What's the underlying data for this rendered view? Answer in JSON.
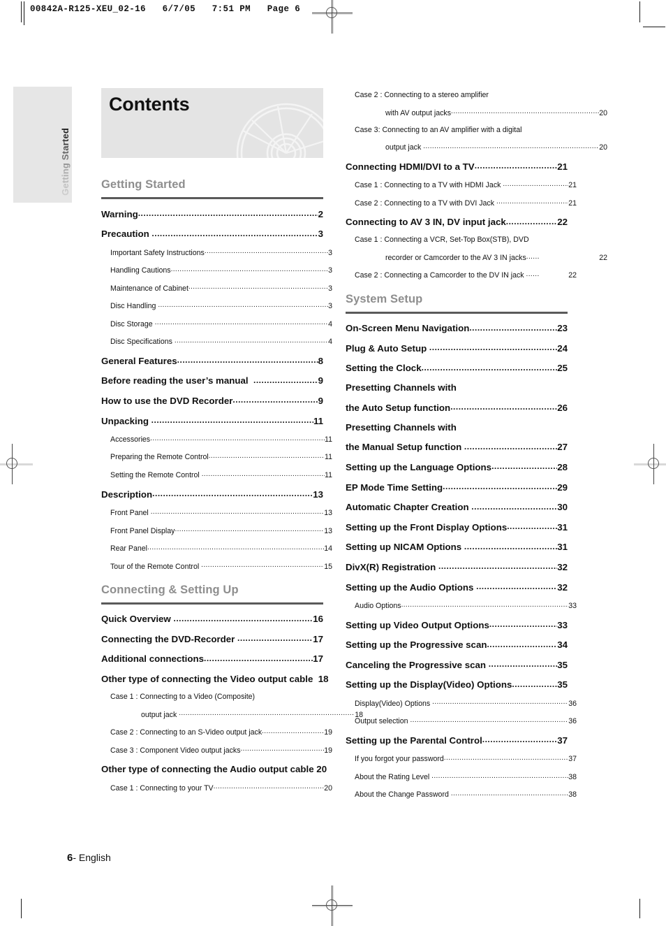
{
  "print_slug": "00842A-R125-XEU_02-16   6/7/05   7:51 PM   Page 6",
  "side_tab": {
    "label": "Getting Started"
  },
  "banner": {
    "title": "Contents",
    "graphic": "dvd-disc-illustration"
  },
  "footer": {
    "page_number": "6",
    "language": "- English"
  },
  "colors": {
    "banner_bg": "#e4e4e4",
    "section_heading": "#8e8e8e",
    "section_rule": "#5a5a5a",
    "text": "#111111",
    "side_tab_bg": "#e6e6e6"
  },
  "columns": {
    "left": [
      {
        "type": "section",
        "label": "Getting Started",
        "entries": [
          {
            "level": 1,
            "text": "Warning",
            "page": "2"
          },
          {
            "level": 1,
            "text": "Precaution ",
            "page": "3"
          },
          {
            "level": 2,
            "text": "Important Safety Instructions",
            "page": "3"
          },
          {
            "level": 2,
            "text": "Handling Cautions",
            "page": "3"
          },
          {
            "level": 2,
            "text": "Maintenance of Cabinet",
            "page": "3"
          },
          {
            "level": 2,
            "text": "Disc Handling ",
            "page": "3"
          },
          {
            "level": 2,
            "text": "Disc Storage ",
            "page": "4"
          },
          {
            "level": 2,
            "text": "Disc Specifications ",
            "page": "4"
          },
          {
            "level": 1,
            "text": "General Features",
            "page": "8"
          },
          {
            "level": 1,
            "text": "Before reading the user’s manual  ",
            "page": "9"
          },
          {
            "level": 1,
            "text": "How to use the DVD Recorder",
            "page": "9"
          },
          {
            "level": 1,
            "text": "Unpacking ",
            "page": "11"
          },
          {
            "level": 2,
            "text": "Accessories",
            "page": "11"
          },
          {
            "level": 2,
            "text": "Preparing the Remote Control",
            "page": "11"
          },
          {
            "level": 2,
            "text": "Setting the Remote Control ",
            "page": "11"
          },
          {
            "level": 1,
            "text": "Description",
            "page": "13"
          },
          {
            "level": 2,
            "text": "Front Panel ",
            "page": "13"
          },
          {
            "level": 2,
            "text": "Front Panel Display",
            "page": "13"
          },
          {
            "level": 2,
            "text": "Rear Panel",
            "page": "14"
          },
          {
            "level": 2,
            "text": "Tour of the Remote Control ",
            "page": "15"
          }
        ]
      },
      {
        "type": "section",
        "label": "Connecting & Setting Up",
        "entries": [
          {
            "level": 1,
            "text": "Quick Overview ",
            "page": "16"
          },
          {
            "level": 1,
            "text": "Connecting the DVD-Recorder ",
            "page": "17"
          },
          {
            "level": 1,
            "text": "Additional connections",
            "page": "17"
          },
          {
            "level": 1,
            "text": "Other type of connecting the Video output cable  ",
            "page": "18",
            "nodots": true
          },
          {
            "level": 2,
            "text": "Case 1 : Connecting to a Video (Composite)",
            "page": "",
            "nopage": true
          },
          {
            "level": 3,
            "text": "output jack ",
            "page": "18"
          },
          {
            "level": 2,
            "text": "Case 2 : Connecting to an S-Video output jack",
            "page": "19"
          },
          {
            "level": 2,
            "text": "Case 3 : Component Video output jacks",
            "page": "19"
          },
          {
            "level": 1,
            "text": "Other type of connecting the Audio output cable ",
            "page": "20",
            "nodots": true
          },
          {
            "level": 2,
            "text": "Case 1 : Connecting to your TV",
            "page": "20"
          }
        ]
      }
    ],
    "right": [
      {
        "type": "continuation",
        "label": "",
        "entries": [
          {
            "level": 2,
            "text": "Case 2 : Connecting to a stereo amplifier",
            "page": "",
            "nopage": true
          },
          {
            "level": 3,
            "text": "with AV output jacks",
            "page": "20"
          },
          {
            "level": 2,
            "text": "Case 3: Connecting to an AV amplifier with a digital",
            "page": "",
            "nopage": true
          },
          {
            "level": 3,
            "text": "output jack ",
            "page": "20"
          },
          {
            "level": 1,
            "text": "Connecting HDMI/DVI to a TV",
            "page": "21"
          },
          {
            "level": 2,
            "text": "Case 1 : Connecting to a TV with HDMI Jack ",
            "page": "21"
          },
          {
            "level": 2,
            "text": "Case 2 : Connecting to a TV with DVI Jack ",
            "page": "21"
          },
          {
            "level": 1,
            "text": "Connecting to AV 3 IN, DV input jack",
            "page": "22"
          },
          {
            "level": 2,
            "text": "Case 1 : Connecting a VCR, Set-Top Box(STB), DVD",
            "page": "",
            "nopage": true
          },
          {
            "level": 3,
            "text": "recorder or Camcorder to the AV 3 IN jacks",
            "page": "22",
            "nodots": true
          },
          {
            "level": 2,
            "text": "Case 2 : Connecting a Camcorder to the DV IN jack ",
            "page": "22",
            "nodots": true
          }
        ]
      },
      {
        "type": "section",
        "label": "System Setup",
        "entries": [
          {
            "level": 1,
            "text": "On-Screen Menu Navigation",
            "page": "23"
          },
          {
            "level": 1,
            "text": "Plug & Auto Setup ",
            "page": "24"
          },
          {
            "level": 1,
            "text": "Setting the Clock",
            "page": "25"
          },
          {
            "level": 1,
            "text": "Presetting Channels with",
            "page": "",
            "nopage": true
          },
          {
            "level": 1,
            "text": "the Auto Setup function",
            "page": "26"
          },
          {
            "level": 1,
            "text": "Presetting Channels with",
            "page": "",
            "nopage": true
          },
          {
            "level": 1,
            "text": "the Manual Setup function ",
            "page": "27"
          },
          {
            "level": 1,
            "text": "Setting up the Language Options",
            "page": "28"
          },
          {
            "level": 1,
            "text": "EP Mode Time Setting",
            "page": "29"
          },
          {
            "level": 1,
            "text": "Automatic Chapter Creation ",
            "page": "30"
          },
          {
            "level": 1,
            "text": "Setting up the Front Display Options",
            "page": "31"
          },
          {
            "level": 1,
            "text": "Setting up NICAM Options ",
            "page": "31"
          },
          {
            "level": 1,
            "text": "DivX(R) Registration ",
            "page": "32"
          },
          {
            "level": 1,
            "text": "Setting up the Audio Options ",
            "page": "32"
          },
          {
            "level": 2,
            "text": "Audio Options",
            "page": "33"
          },
          {
            "level": 1,
            "text": "Setting up Video Output Options",
            "page": "33"
          },
          {
            "level": 1,
            "text": "Setting up the Progressive scan",
            "page": "34"
          },
          {
            "level": 1,
            "text": "Canceling the Progressive scan ",
            "page": "35"
          },
          {
            "level": 1,
            "text": "Setting up the Display(Video) Options",
            "page": "35"
          },
          {
            "level": 2,
            "text": "Display(Video) Options ",
            "page": "36"
          },
          {
            "level": 2,
            "text": "Output selection ",
            "page": "36"
          },
          {
            "level": 1,
            "text": "Setting up the Parental Control",
            "page": "37"
          },
          {
            "level": 2,
            "text": "If you forgot your password",
            "page": "37"
          },
          {
            "level": 2,
            "text": "About the Rating Level ",
            "page": "38"
          },
          {
            "level": 2,
            "text": "About the Change Password ",
            "page": "38"
          }
        ]
      }
    ]
  }
}
